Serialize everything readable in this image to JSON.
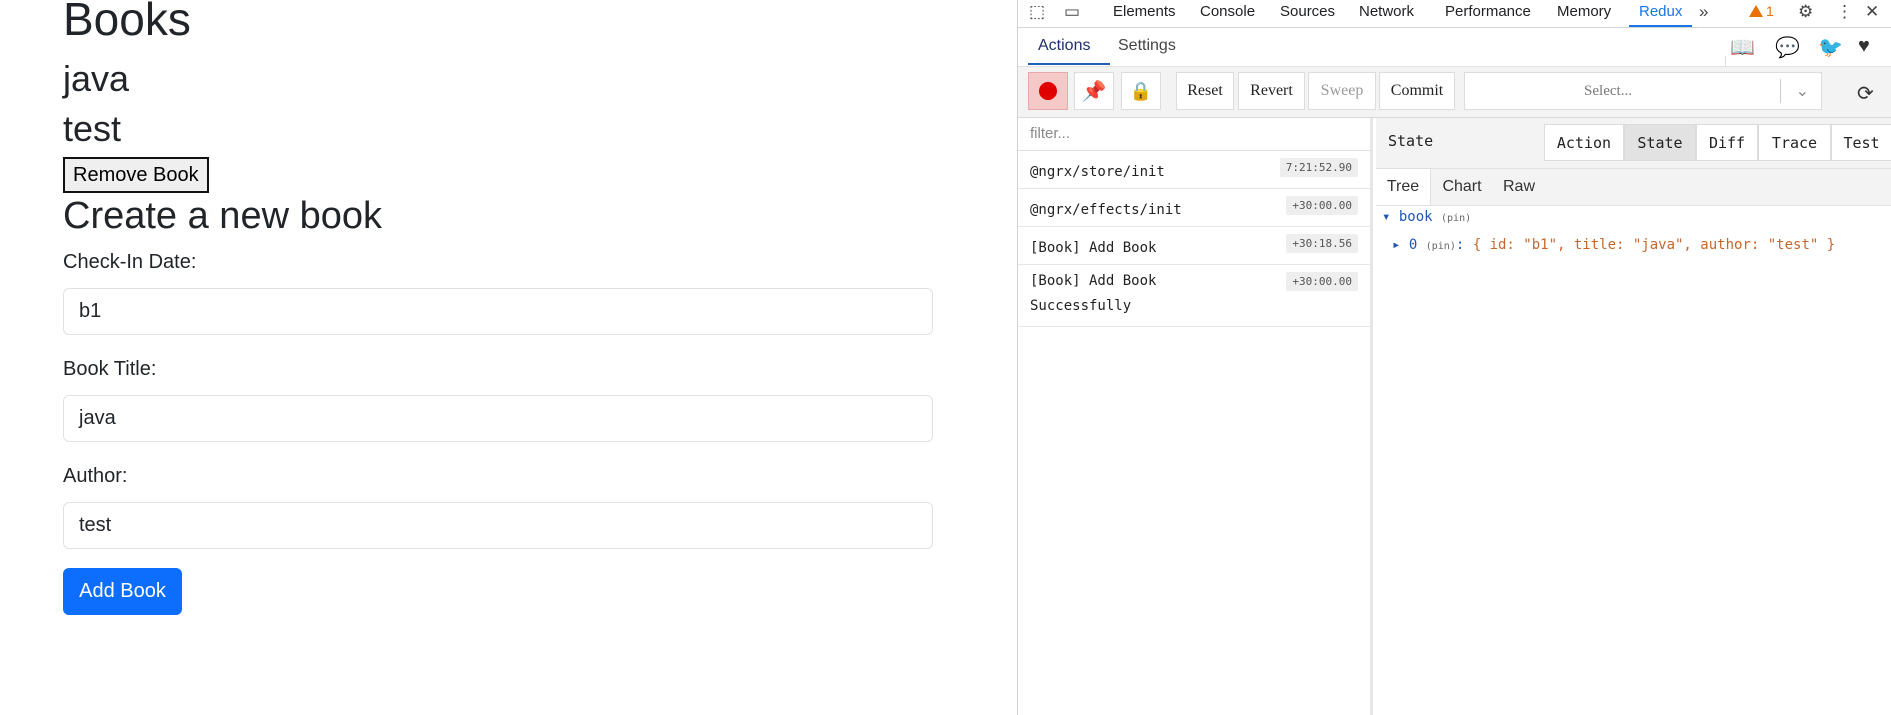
{
  "app": {
    "heading": "Books",
    "book_title": "java",
    "book_author": "test",
    "remove_button": "Remove Book",
    "form_heading": "Create a new book",
    "fields": [
      {
        "label": "Check-In Date:",
        "value": "b1"
      },
      {
        "label": "Book Title:",
        "value": "java"
      },
      {
        "label": "Author:",
        "value": "test"
      }
    ],
    "add_button": "Add Book"
  },
  "devtools": {
    "tabs": [
      "Elements",
      "Console",
      "Sources",
      "Network",
      "Performance",
      "Memory",
      "Redux"
    ],
    "active_tab": "Redux",
    "warning_count": "1",
    "redux_nav": {
      "actions": "Actions",
      "settings": "Settings"
    },
    "toolbar": {
      "reset": "Reset",
      "revert": "Revert",
      "sweep": "Sweep",
      "commit": "Commit",
      "select_placeholder": "Select..."
    },
    "filter_placeholder": "filter...",
    "actions": [
      {
        "name": "@ngrx/store/init",
        "time": "7:21:52.90"
      },
      {
        "name": "@ngrx/effects/init",
        "time": "+30:00.00"
      },
      {
        "name": "[Book] Add Book",
        "time": "+30:18.56"
      },
      {
        "name": "[Book] Add Book Successfully",
        "time": "+30:00.00"
      }
    ],
    "state_title": "State",
    "state_tabs": [
      "Action",
      "State",
      "Diff",
      "Trace",
      "Test"
    ],
    "view_tabs": [
      "Tree",
      "Chart",
      "Raw"
    ],
    "tree": {
      "root_key": "book",
      "pin": "(pin)",
      "child_key": "0",
      "child_value": "{ id: \"b1\", title: \"java\", author: \"test\" }"
    }
  }
}
